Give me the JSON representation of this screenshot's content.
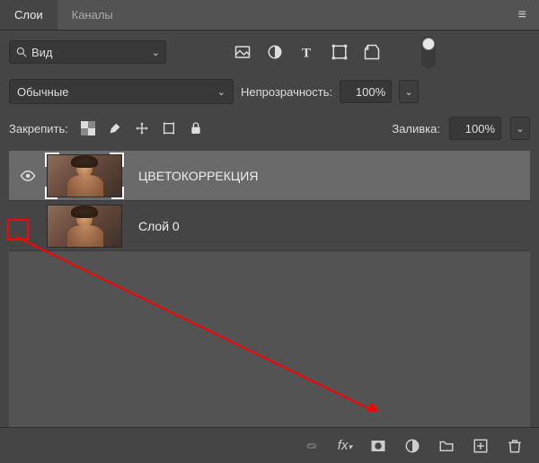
{
  "tabs": {
    "layers": "Слои",
    "channels": "Каналы"
  },
  "search": {
    "value": "Вид"
  },
  "blend_mode": {
    "value": "Обычные"
  },
  "opacity": {
    "label": "Непрозрачность:",
    "value": "100%"
  },
  "lock": {
    "label": "Закрепить:"
  },
  "fill": {
    "label": "Заливка:",
    "value": "100%"
  },
  "layers_list": [
    {
      "name": "ЦВЕТОКОРРЕКЦИЯ",
      "visible": true,
      "selected": true
    },
    {
      "name": "Слой 0",
      "visible": false,
      "selected": false
    }
  ],
  "icons": {
    "filter_image": "image-filter",
    "filter_adj": "adjustment-filter",
    "filter_text": "text-filter",
    "filter_shape": "shape-filter",
    "filter_smart": "smartobject-filter",
    "lock_trans": "lock-transparency",
    "lock_paint": "lock-paint",
    "lock_move": "lock-move",
    "lock_art": "lock-artboard",
    "lock_all": "lock-all",
    "bottom_link": "link",
    "bottom_fx": "fx",
    "bottom_mask": "mask",
    "bottom_adj": "adjustment-layer",
    "bottom_group": "group",
    "bottom_new": "new-layer",
    "bottom_trash": "trash"
  }
}
